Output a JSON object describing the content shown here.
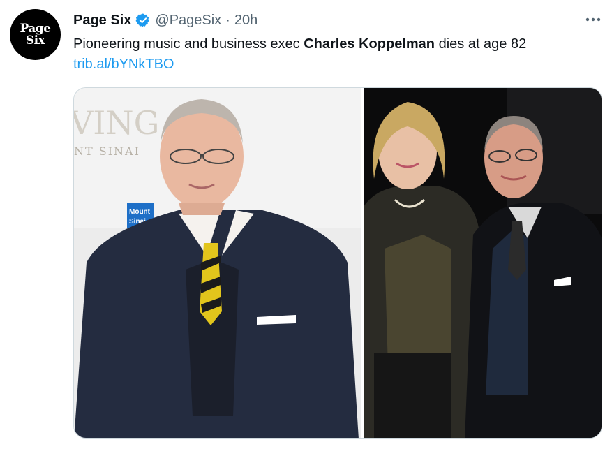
{
  "account": {
    "display_name": "Page Six",
    "handle": "@PageSix",
    "separator": "·",
    "time": "20h",
    "avatar_line1": "Page",
    "avatar_line2": "Six",
    "verified_icon": "verified-badge-icon",
    "brand_color": "#1d9bf0"
  },
  "tweet": {
    "text_before": "Pioneering music and business exec ",
    "text_bold": "Charles Koppelman",
    "text_after": " dies at age 82",
    "link": "trib.al/bYNkTBO"
  },
  "media": {
    "backdrop_text_1": "VING",
    "backdrop_text_2": "NT SINAI",
    "logo_line1": "Mount",
    "logo_line2": "Sinai"
  },
  "menu": {
    "more_icon": "more-horizontal-icon"
  }
}
